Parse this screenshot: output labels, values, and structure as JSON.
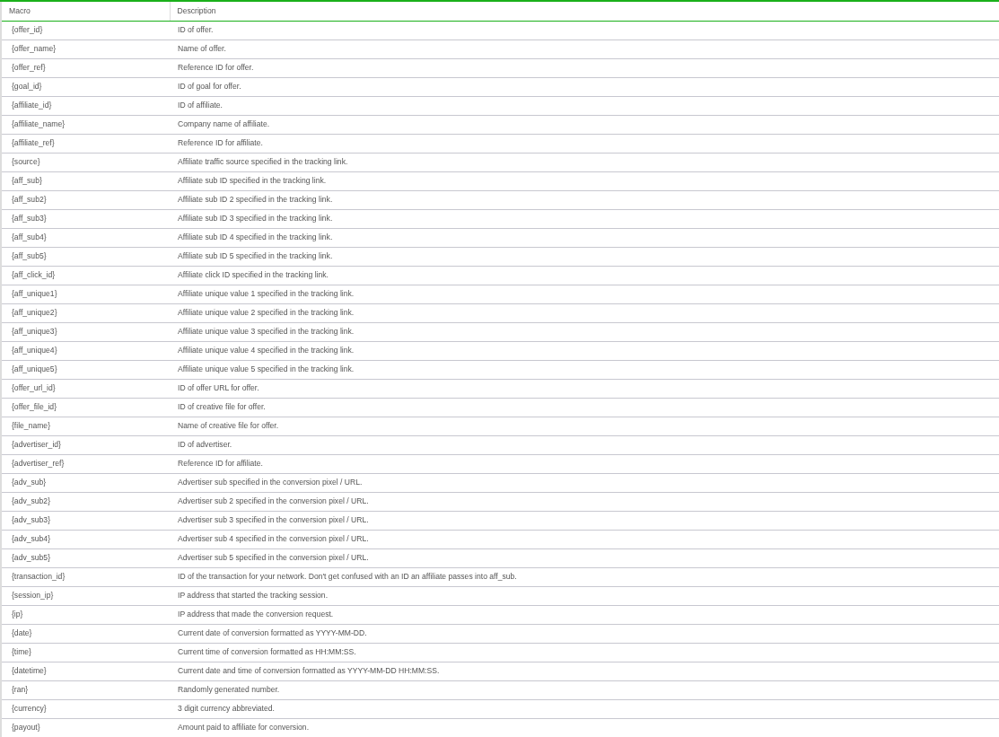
{
  "table": {
    "columns": [
      "Macro",
      "Description"
    ],
    "rows": [
      [
        "{offer_id}",
        "ID of offer."
      ],
      [
        "{offer_name}",
        "Name of offer."
      ],
      [
        "{offer_ref}",
        "Reference ID for offer."
      ],
      [
        "{goal_id}",
        "ID of goal for offer."
      ],
      [
        "{affiliate_id}",
        "ID of affiliate."
      ],
      [
        "{affiliate_name}",
        "Company name of affiliate."
      ],
      [
        "{affiliate_ref}",
        "Reference ID for affiliate."
      ],
      [
        "{source}",
        "Affiliate traffic source specified in the tracking link."
      ],
      [
        "{aff_sub}",
        "Affiliate sub ID specified in the tracking link."
      ],
      [
        "{aff_sub2}",
        "Affiliate sub ID 2 specified in the tracking link."
      ],
      [
        "{aff_sub3}",
        "Affiliate sub ID 3 specified in the tracking link."
      ],
      [
        "{aff_sub4}",
        "Affiliate sub ID 4 specified in the tracking link."
      ],
      [
        "{aff_sub5}",
        "Affiliate sub ID 5 specified in the tracking link."
      ],
      [
        "{aff_click_id}",
        "Affiliate click ID specified in the tracking link."
      ],
      [
        "{aff_unique1}",
        "Affiliate unique value 1 specified in the tracking link."
      ],
      [
        "{aff_unique2}",
        "Affiliate unique value 2 specified in the tracking link."
      ],
      [
        "{aff_unique3}",
        "Affiliate unique value 3 specified in the tracking link."
      ],
      [
        "{aff_unique4}",
        "Affiliate unique value 4 specified in the tracking link."
      ],
      [
        "{aff_unique5}",
        "Affiliate unique value 5 specified in the tracking link."
      ],
      [
        "{offer_url_id}",
        "ID of offer URL for offer."
      ],
      [
        "{offer_file_id}",
        "ID of creative file for offer."
      ],
      [
        "{file_name}",
        "Name of creative file for offer."
      ],
      [
        "{advertiser_id}",
        "ID of advertiser."
      ],
      [
        "{advertiser_ref}",
        "Reference ID for affiliate."
      ],
      [
        "{adv_sub}",
        "Advertiser sub specified in the conversion pixel / URL."
      ],
      [
        "{adv_sub2}",
        "Advertiser sub 2 specified in the conversion pixel / URL."
      ],
      [
        "{adv_sub3}",
        "Advertiser sub 3 specified in the conversion pixel / URL."
      ],
      [
        "{adv_sub4}",
        "Advertiser sub 4 specified in the conversion pixel / URL."
      ],
      [
        "{adv_sub5}",
        "Advertiser sub 5 specified in the conversion pixel / URL."
      ],
      [
        "{transaction_id}",
        "ID of the transaction for your network. Don't get confused with an ID an affiliate passes into aff_sub."
      ],
      [
        "{session_ip}",
        "IP address that started the tracking session."
      ],
      [
        "{ip}",
        "IP address that made the conversion request."
      ],
      [
        "{date}",
        "Current date of conversion formatted as YYYY-MM-DD."
      ],
      [
        "{time}",
        "Current time of conversion formatted as HH:MM:SS."
      ],
      [
        "{datetime}",
        "Current date and time of conversion formatted as YYYY-MM-DD HH:MM:SS."
      ],
      [
        "{ran}",
        "Randomly generated number."
      ],
      [
        "{currency}",
        "3 digit currency abbreviated."
      ],
      [
        "{payout}",
        "Amount paid to affiliate for conversion."
      ]
    ]
  }
}
